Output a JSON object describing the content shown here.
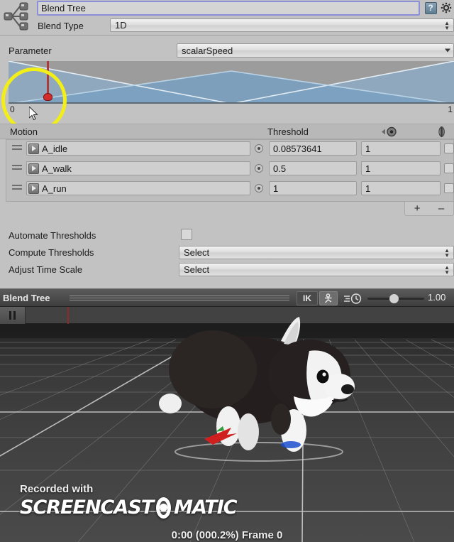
{
  "inspector": {
    "asset_name": "Blend Tree",
    "header_icon": "blend-tree-icon",
    "help_icon": "?",
    "gear_icon": "gear-icon",
    "blend_type": {
      "label": "Blend Type",
      "value": "1D"
    },
    "parameter": {
      "label": "Parameter",
      "value": "scalarSpeed"
    },
    "graph": {
      "axis_min": "0",
      "axis_max": "1",
      "playhead_value": 0.086,
      "fill_color": "#7fa2bd",
      "line_color": "#d7e4ee",
      "bg_color": "#9c9c9c",
      "highlight_color": "#f2ef18"
    },
    "table": {
      "columns": [
        "Motion",
        "Threshold",
        "time-icon",
        "mirror-icon"
      ],
      "rows": [
        {
          "motion": "A_idle",
          "threshold": "0.08573641",
          "speed": "1",
          "mirror": false
        },
        {
          "motion": "A_walk",
          "threshold": "0.5",
          "speed": "1",
          "mirror": false
        },
        {
          "motion": "A_run",
          "threshold": "1",
          "speed": "1",
          "mirror": false
        }
      ],
      "add_label": "+",
      "remove_label": "–"
    },
    "settings": {
      "automate_thresholds": {
        "label": "Automate Thresholds",
        "checked": false
      },
      "compute_thresholds": {
        "label": "Compute Thresholds",
        "value": "Select"
      },
      "adjust_time_scale": {
        "label": "Adjust Time Scale",
        "value": "Select"
      }
    }
  },
  "preview": {
    "title": "Blend Tree",
    "ik_label": "IK",
    "avatar_icon": "avatar-icon",
    "speed_icon": "playback-speed-icon",
    "speed_value": "1.00",
    "pause_icon": "pause-icon",
    "frame_status": "0:00 (000.2%) Frame 0"
  },
  "watermark": {
    "recorded_with": "Recorded with",
    "brand_left": "SCREENCAST",
    "brand_right": "MATIC"
  }
}
